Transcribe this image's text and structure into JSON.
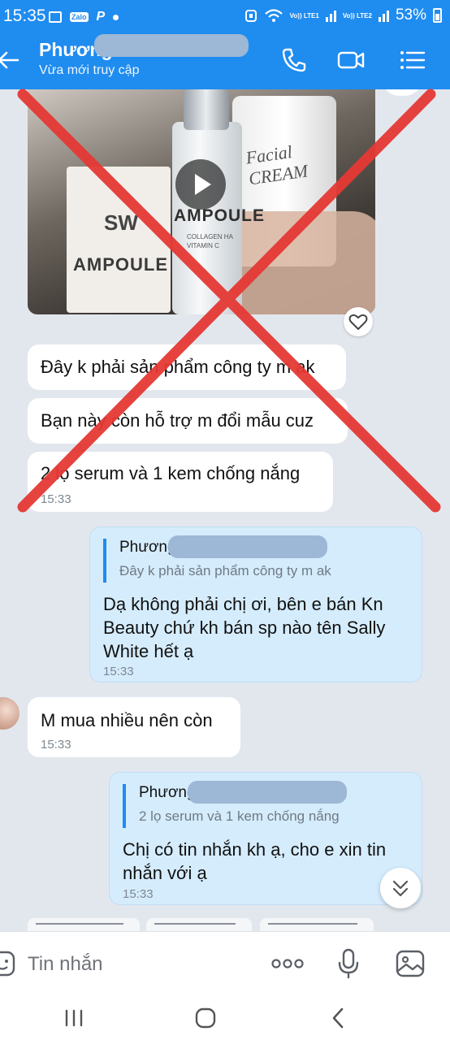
{
  "status_bar": {
    "time": "15:35",
    "zalo_label": "Zalo",
    "p_label": "P",
    "volte1": "Vo)) LTE1",
    "volte2": "Vo)) LTE2",
    "battery": "53%"
  },
  "header": {
    "contact_name": "Phương",
    "contact_status": "Vừa mới truy cập",
    "accent_color": "#1f8cf0"
  },
  "video": {
    "jar_label": "Facial CREAM",
    "box_label": "AMPOULE",
    "box_logo": "SW",
    "bottle_label": "AMPOULE",
    "bottle_sub": "COLLAGEN HA VITAMIN C"
  },
  "messages": {
    "in1": {
      "text": "Đây k phải sản phẩm công ty m ak"
    },
    "in2": {
      "text": "Bạn này còn hỗ trợ m đổi mẫu cuz"
    },
    "in3": {
      "text": "2 lọ serum và 1 kem chống nắng",
      "time": "15:33"
    },
    "out1": {
      "quote_name": "Phương",
      "quote_text": "Đây k phải sản phẩm công ty m ak",
      "text": "Dạ không phải chị ơi, bên e bán Kn Beauty chứ kh bán sp nào tên Sally White hết ạ",
      "time": "15:33"
    },
    "in4": {
      "text": "M mua nhiều nên còn",
      "time": "15:33"
    },
    "out2": {
      "quote_name": "Phương",
      "quote_text": "2 lọ serum và 1 kem chống nắng",
      "text": "Chị có tin nhắn kh ạ, cho e xin tin nhắn với ạ",
      "time": "15:33"
    }
  },
  "input": {
    "placeholder": "Tin nhắn"
  },
  "overlay": {
    "cross_color": "#e53935"
  }
}
